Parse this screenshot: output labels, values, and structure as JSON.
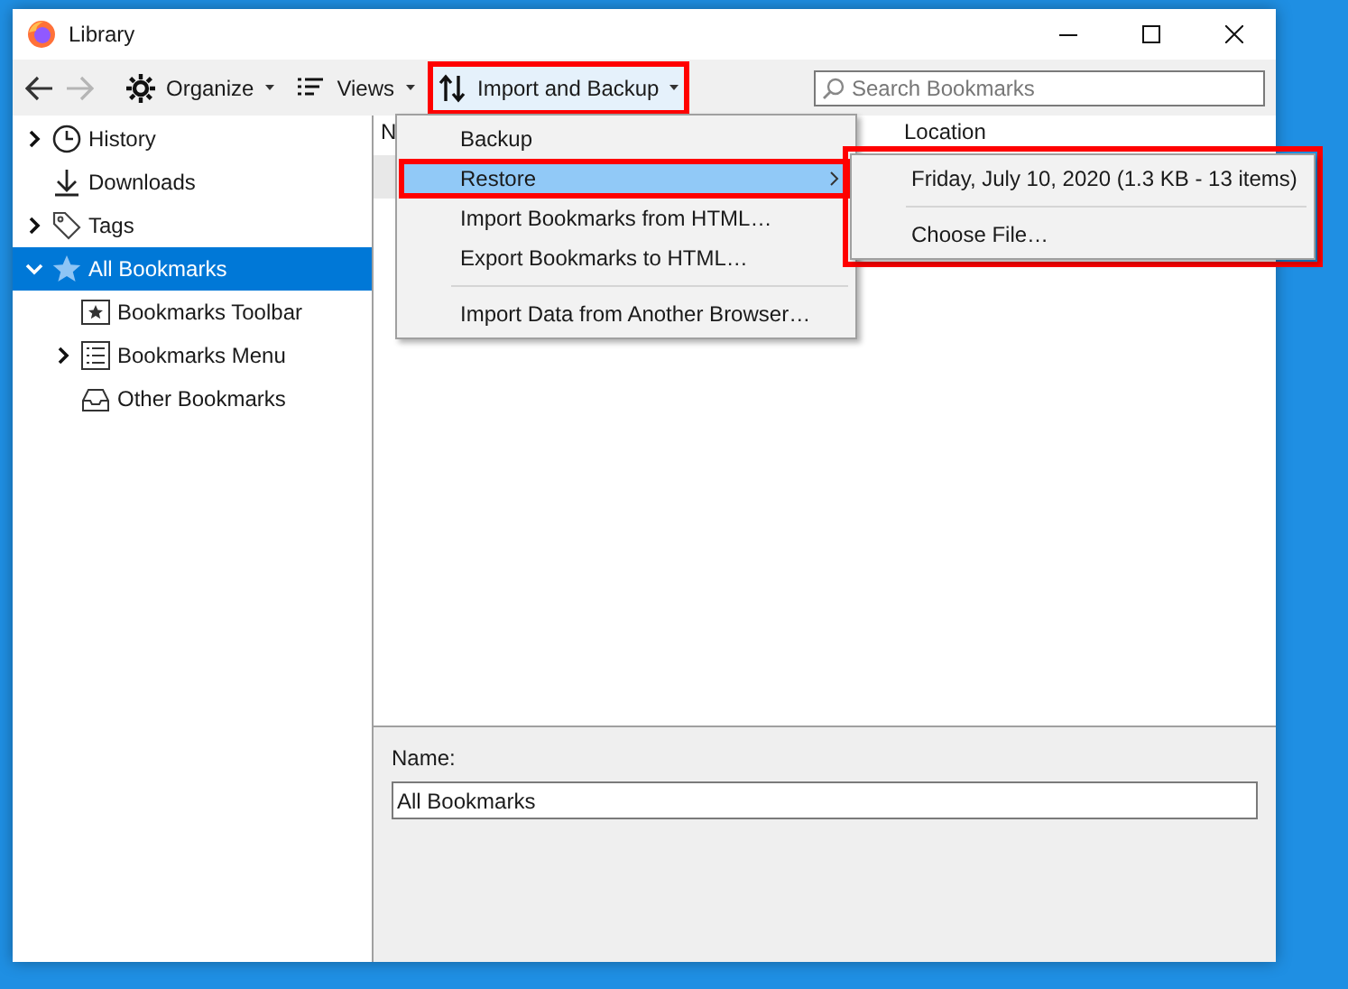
{
  "window": {
    "title": "Library"
  },
  "toolbar": {
    "buttons": [
      {
        "label": "Organize",
        "has_dropdown": true,
        "highlighted": false
      },
      {
        "label": "Views",
        "has_dropdown": true,
        "highlighted": false
      },
      {
        "label": "Import and Backup",
        "has_dropdown": true,
        "highlighted": true
      }
    ]
  },
  "search": {
    "placeholder": "Search Bookmarks"
  },
  "sidebar": {
    "items": [
      {
        "label": "History",
        "selected": false,
        "expanded": false
      },
      {
        "label": "Downloads",
        "selected": false
      },
      {
        "label": "Tags",
        "selected": false,
        "expanded": false
      },
      {
        "label": "All Bookmarks",
        "selected": true,
        "expanded": true,
        "children": [
          {
            "label": "Bookmarks Toolbar",
            "selected": false
          },
          {
            "label": "Bookmarks Menu",
            "selected": false,
            "expanded": false
          },
          {
            "label": "Other Bookmarks",
            "selected": false
          }
        ]
      }
    ]
  },
  "table": {
    "columns": [
      "N",
      "Location"
    ]
  },
  "menu": {
    "items": [
      {
        "kind": "item",
        "label": "Backup",
        "selected": false,
        "submenu": false,
        "highlighted": false
      },
      {
        "kind": "item",
        "label": "Restore",
        "selected": true,
        "submenu": true,
        "highlighted": true
      },
      {
        "kind": "item",
        "label": "Import Bookmarks from HTML…",
        "selected": false,
        "submenu": false,
        "highlighted": false
      },
      {
        "kind": "item",
        "label": "Export Bookmarks to HTML…",
        "selected": false,
        "submenu": false,
        "highlighted": false
      },
      {
        "kind": "separator"
      },
      {
        "kind": "item",
        "label": "Import Data from Another Browser…",
        "selected": false,
        "submenu": false,
        "highlighted": false
      }
    ]
  },
  "submenu": {
    "highlighted": true,
    "items": [
      {
        "kind": "item",
        "label": "Friday, July 10, 2020 (1.3 KB - 13 items)"
      },
      {
        "kind": "separator"
      },
      {
        "kind": "item",
        "label": "Choose File…"
      }
    ]
  },
  "details": {
    "name_label": "Name:",
    "name_value": "All Bookmarks"
  }
}
